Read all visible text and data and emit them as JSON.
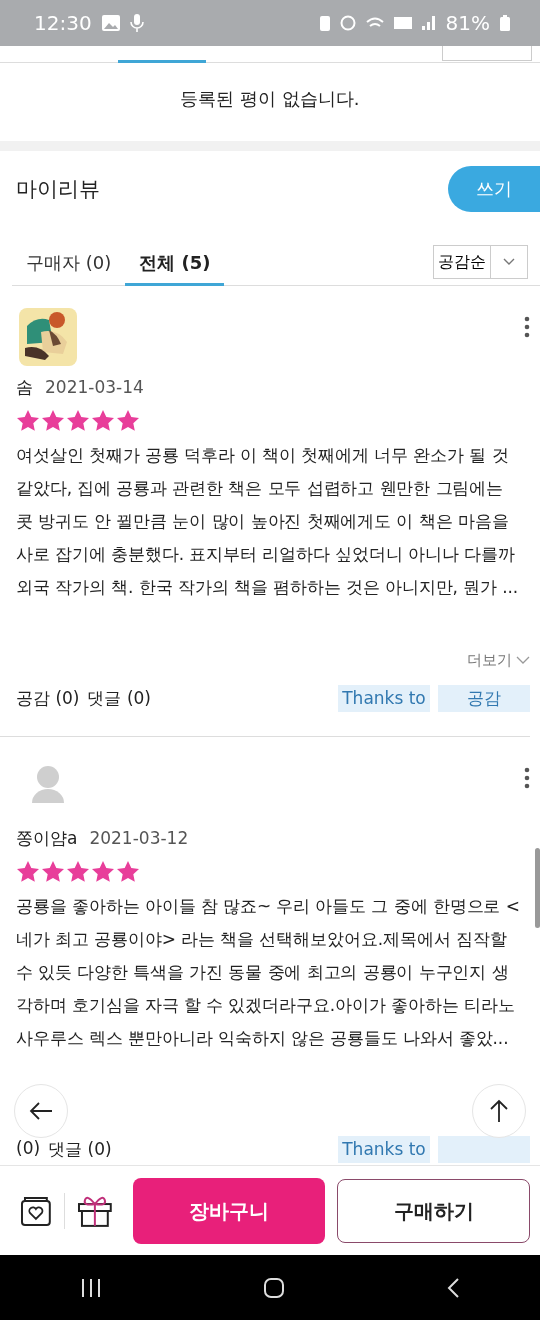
{
  "status_bar": {
    "time": "12:30",
    "battery": "81%"
  },
  "empty_message": "등록된 평이 없습니다.",
  "section": {
    "title": "마이리뷰",
    "write_button": "쓰기"
  },
  "tabs": [
    {
      "label": "구매자 (0)",
      "selected": false
    },
    {
      "label": "전체 (5)",
      "selected": true
    }
  ],
  "sort": {
    "value": "공감순"
  },
  "reviews": [
    {
      "name": "솜",
      "date": "2021-03-14",
      "stars": 5,
      "body": "여섯살인 첫째가 공룡 덕후라 이 책이 첫째에게 너무 완소가 될 것 같았다, 집에 공룡과 관련한 책은 모두 섭렵하고 웬만한 그림에는 콧 방귀도 안 뀔만큼 눈이 많이 높아진 첫째에게도 이 책은 마음을 사로 잡기에 충분했다. 표지부터 리얼하다 싶었더니 아니나 다를까 외국 작가의 책. 한국 작가의 책을 폄하하는 것은 아니지만, 뭔가 ...",
      "more": "더보기",
      "likes": "공감 (0)",
      "comments": "댓글 (0)",
      "thanks_button": "Thanks to",
      "like_button": "공감"
    },
    {
      "avatar": {
        "kind": "default"
      },
      "name": "쫑이얌a",
      "date": "2021-03-12",
      "stars": 5,
      "body": "공룡을 좋아하는 아이들 참 많죠~ 우리 아들도 그 중에 한명으로 < 네가 최고 공룡이야> 라는 책을 선택해보았어요.제목에서 짐작할 수 있듯 다양한 특색을 가진 동물 중에 최고의 공룡이 누구인지 생각하며 호기심을 자극 할 수 있겠더라구요.아이가 좋아하는 티라노 사우루스 렉스 뿐만아니라 익숙하지 않은 공룡들도 나와서 좋았...",
      "likes": "(0)",
      "comments": "댓글 (0)",
      "thanks_button": "Thanks to"
    }
  ],
  "bottom_bar": {
    "cart_button": "장바구니",
    "buy_button": "구매하기"
  }
}
